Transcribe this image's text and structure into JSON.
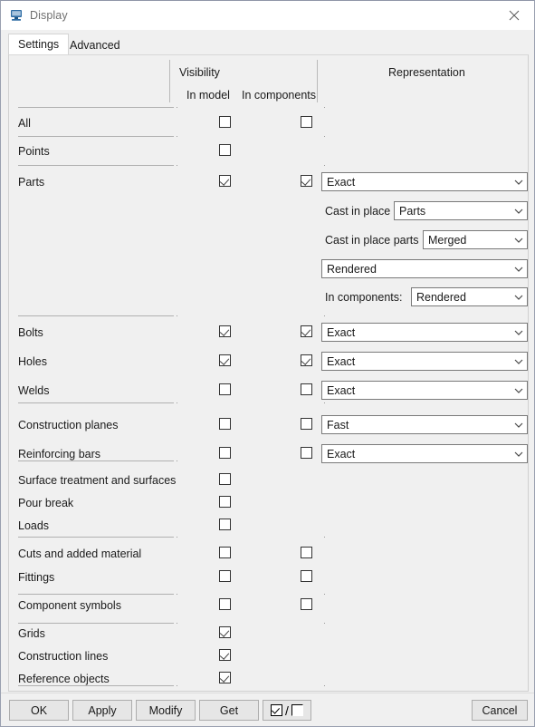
{
  "window": {
    "title": "Display",
    "icon": "display-monitor-icon",
    "close_icon": "close-icon"
  },
  "tabs": [
    {
      "label": "Settings",
      "active": true
    },
    {
      "label": "Advanced",
      "active": false
    }
  ],
  "columns": {
    "visibility": "Visibility",
    "in_model": "In model",
    "in_components": "In components",
    "representation": "Representation"
  },
  "rows": [
    {
      "label": "All",
      "in_model": false,
      "in_components": false,
      "rep": null
    },
    {
      "label": "Points",
      "in_model": false,
      "in_components": null,
      "rep": null
    },
    {
      "label": "Parts",
      "in_model": true,
      "in_components": true,
      "rep": "Exact"
    },
    {
      "label": "Bolts",
      "in_model": true,
      "in_components": true,
      "rep": "Exact"
    },
    {
      "label": "Holes",
      "in_model": true,
      "in_components": true,
      "rep": "Exact"
    },
    {
      "label": "Welds",
      "in_model": false,
      "in_components": false,
      "rep": "Exact"
    },
    {
      "label": "Construction planes",
      "in_model": false,
      "in_components": false,
      "rep": "Fast"
    },
    {
      "label": "Reinforcing bars",
      "in_model": false,
      "in_components": false,
      "rep": "Exact"
    },
    {
      "label": "Surface treatment and surfaces",
      "in_model": false,
      "in_components": null,
      "rep": null
    },
    {
      "label": "Pour break",
      "in_model": false,
      "in_components": null,
      "rep": null
    },
    {
      "label": "Loads",
      "in_model": false,
      "in_components": null,
      "rep": null
    },
    {
      "label": "Cuts and added material",
      "in_model": false,
      "in_components": false,
      "rep": null
    },
    {
      "label": "Fittings",
      "in_model": false,
      "in_components": false,
      "rep": null
    },
    {
      "label": "Component symbols",
      "in_model": false,
      "in_components": false,
      "rep": null
    },
    {
      "label": "Grids",
      "in_model": true,
      "in_components": null,
      "rep": null
    },
    {
      "label": "Construction lines",
      "in_model": true,
      "in_components": null,
      "rep": null
    },
    {
      "label": "Reference objects",
      "in_model": true,
      "in_components": null,
      "rep": null
    }
  ],
  "parts_extra": {
    "cast_in_place_label": "Cast in place",
    "cast_in_place_value": "Parts",
    "cast_in_place_parts_label": "Cast in place parts",
    "cast_in_place_parts_value": "Merged",
    "rendered_value": "Rendered",
    "in_components_label": "In components:",
    "in_components_value": "Rendered"
  },
  "buttons": {
    "ok": "OK",
    "apply": "Apply",
    "modify": "Modify",
    "get": "Get",
    "cancel": "Cancel",
    "toggle_separator": "/"
  }
}
